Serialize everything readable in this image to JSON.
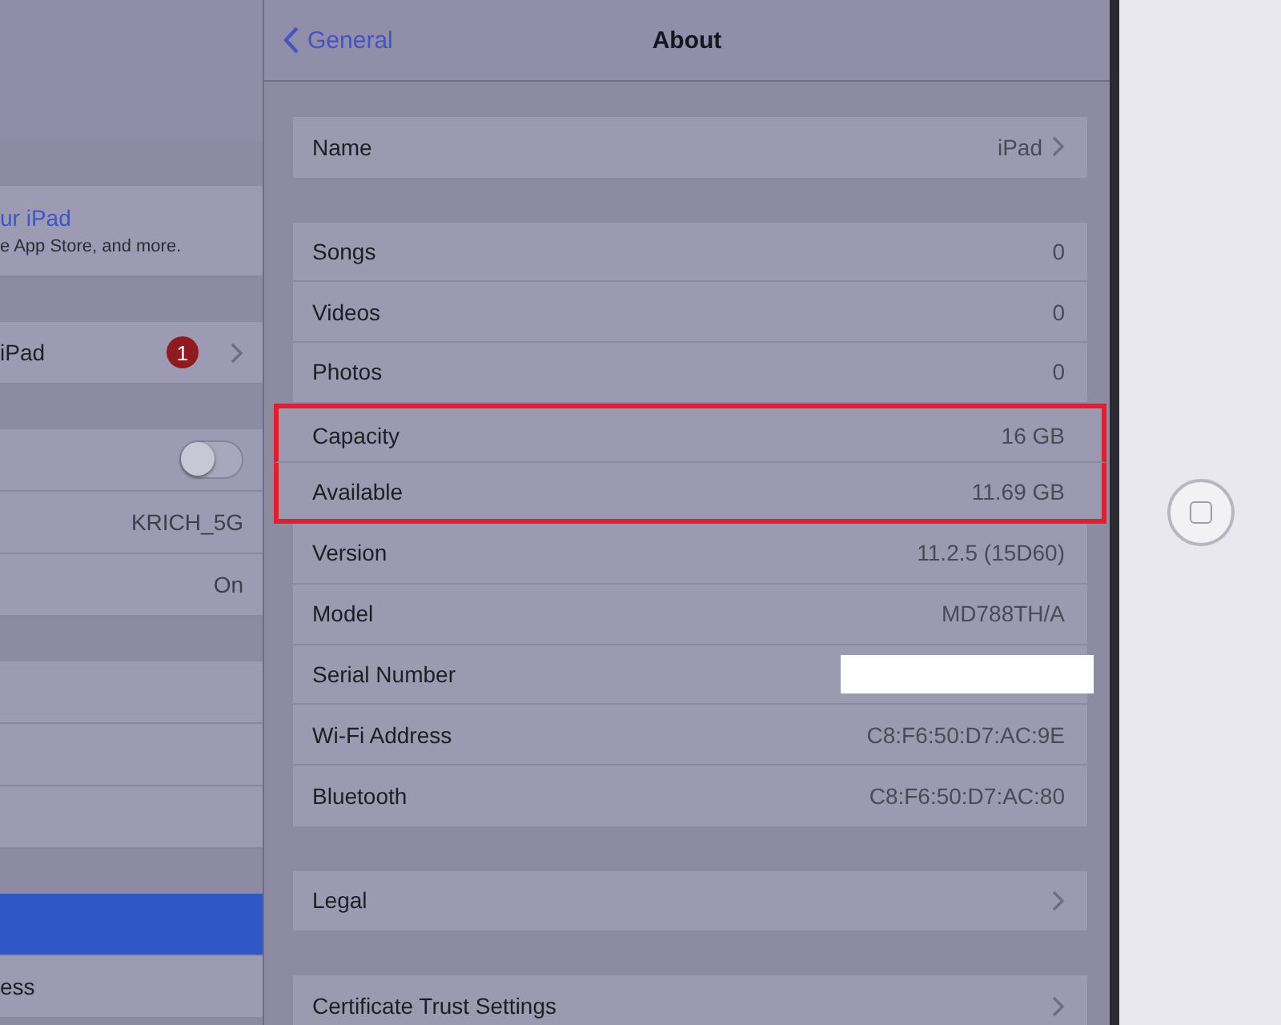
{
  "sidebar": {
    "groups": [
      {
        "items": [
          {
            "kind": "link",
            "title": "ur iPad",
            "subtitle": "e App Store, and more.",
            "selected": false
          }
        ]
      },
      {
        "items": [
          {
            "kind": "badge",
            "label": "iPad",
            "badge": "1",
            "selected": false
          }
        ]
      },
      {
        "items": [
          {
            "kind": "toggle",
            "on": false,
            "selected": false
          },
          {
            "kind": "value",
            "value": "KRICH_5G",
            "selected": false
          },
          {
            "kind": "value",
            "value": "On",
            "selected": false
          }
        ]
      },
      {
        "items": [
          {
            "kind": "blank",
            "selected": false
          },
          {
            "kind": "blank",
            "selected": false
          },
          {
            "kind": "blank",
            "selected": false
          }
        ]
      },
      {
        "items": [
          {
            "kind": "blank",
            "selected": true
          },
          {
            "kind": "label",
            "label": "ess",
            "selected": false
          }
        ]
      }
    ]
  },
  "nav": {
    "back": "General",
    "title": "About"
  },
  "groups": [
    {
      "rows": [
        {
          "label": "Name",
          "value": "iPad",
          "chevron": true,
          "highlighted": false
        }
      ]
    },
    {
      "rows": [
        {
          "label": "Songs",
          "value": "0",
          "chevron": false,
          "highlighted": false
        },
        {
          "label": "Videos",
          "value": "0",
          "chevron": false,
          "highlighted": false
        },
        {
          "label": "Photos",
          "value": "0",
          "chevron": false,
          "highlighted": false
        },
        {
          "label": "Capacity",
          "value": "16 GB",
          "chevron": false,
          "highlighted": true
        },
        {
          "label": "Available",
          "value": "11.69 GB",
          "chevron": false,
          "highlighted": true
        },
        {
          "label": "Version",
          "value": "11.2.5 (15D60)",
          "chevron": false,
          "highlighted": false
        },
        {
          "label": "Model",
          "value": "MD788TH/A",
          "chevron": false,
          "highlighted": false
        },
        {
          "label": "Serial Number",
          "redacted": true,
          "chevron": false,
          "highlighted": false
        },
        {
          "label": "Wi-Fi Address",
          "value": "C8:F6:50:D7:AC:9E",
          "chevron": false,
          "highlighted": false
        },
        {
          "label": "Bluetooth",
          "value": "C8:F6:50:D7:AC:80",
          "chevron": false,
          "highlighted": false
        }
      ]
    },
    {
      "rows": [
        {
          "label": "Legal",
          "chevron": true,
          "highlighted": false
        }
      ]
    },
    {
      "rows": [
        {
          "label": "Certificate Trust Settings",
          "chevron": true,
          "highlighted": false
        }
      ]
    }
  ]
}
